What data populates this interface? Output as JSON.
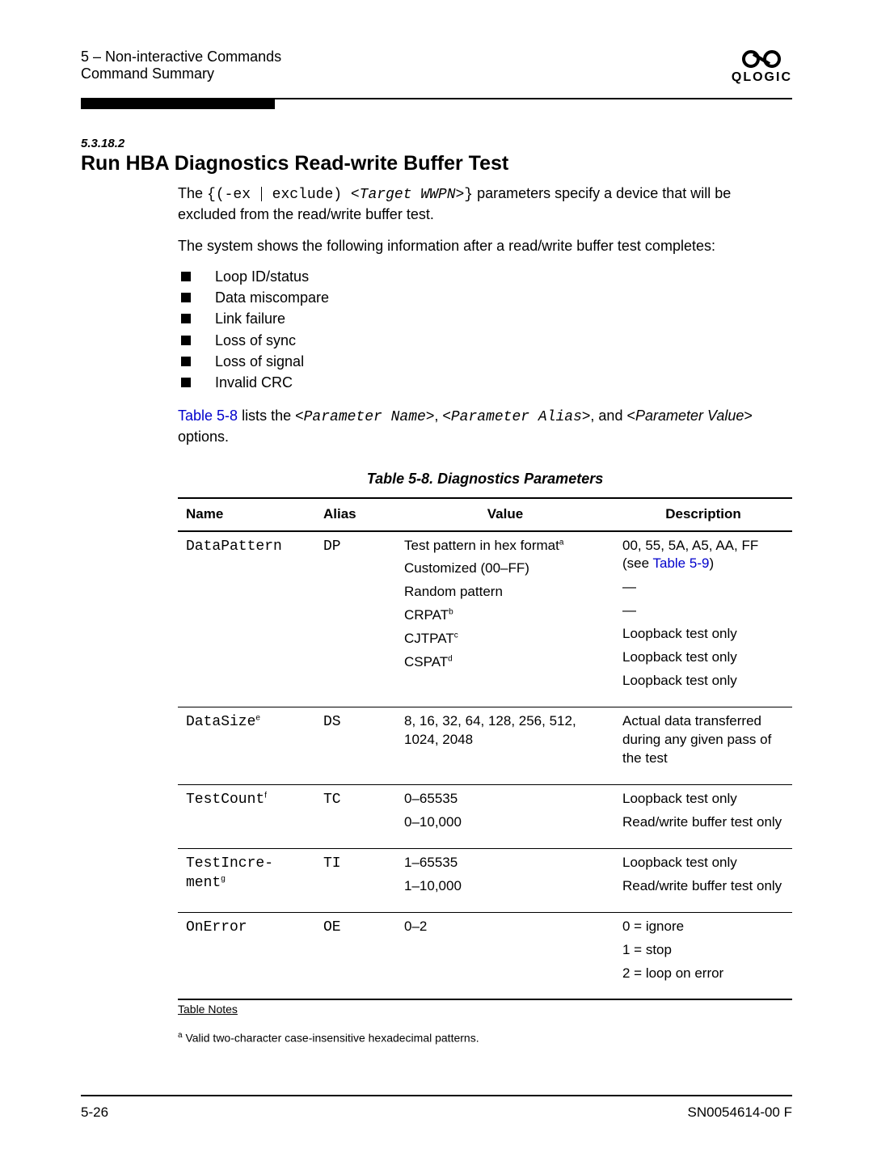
{
  "header": {
    "line1": "5 – Non-interactive Commands",
    "line2": "Command Summary",
    "logo_glyph": "ꭓ",
    "logo_text": "QLOGIC"
  },
  "section": {
    "num": "5.3.18.2",
    "title": "Run HBA Diagnostics Read-write Buffer Test"
  },
  "intro": {
    "p1_parts": {
      "a": "The ",
      "code_a": "{(-ex ",
      "code_b": " exclude) <",
      "code_it": "Target WWPN",
      "code_c": ">}",
      "b": " parameters specify a device that will be excluded from the read/write buffer test."
    },
    "p2": "The system shows the following information after a read/write buffer test completes:",
    "bullets": [
      "Loop ID/status",
      "Data miscompare",
      "Link failure",
      "Loss of sync",
      "Loss of signal",
      "Invalid CRC"
    ],
    "p3_parts": {
      "link": "Table 5-8",
      "t1": " lists the <",
      "m1": "Parameter Name",
      "t2": ">, <",
      "m2": "Parameter Alias",
      "t3": ">, and <",
      "it": "Parameter Value",
      "t4": "> options."
    }
  },
  "table": {
    "caption": "Table 5-8. Diagnostics Parameters",
    "headers": {
      "name": "Name",
      "alias": "Alias",
      "value": "Value",
      "desc": "Description"
    },
    "rows": [
      {
        "name": "DataPattern",
        "alias": "DP",
        "values": [
          {
            "t": "Test pattern in hex format",
            "sup": "a"
          },
          {
            "t": "Customized (00–FF)"
          },
          {
            "t": "Random pattern"
          },
          {
            "t": "CRPAT",
            "sup": "b"
          },
          {
            "t": "CJTPAT",
            "sup": "c"
          },
          {
            "t": "CSPAT",
            "sup": "d"
          }
        ],
        "descs": [
          {
            "t1": "00, 55, 5A, A5, AA, FF",
            "t2": "(see ",
            "link": "Table 5-9",
            "t3": ")"
          },
          {
            "t1": "—"
          },
          {
            "t1": "—"
          },
          {
            "t1": "Loopback test only"
          },
          {
            "t1": "Loopback test only"
          },
          {
            "t1": "Loopback test only"
          }
        ]
      },
      {
        "name": "DataSize",
        "name_sup": "e",
        "alias": "DS",
        "values": [
          {
            "t": "8, 16, 32, 64, 128, 256, 512, 1024, 2048"
          }
        ],
        "descs": [
          {
            "t1": "Actual data transferred during any given pass of the test"
          }
        ]
      },
      {
        "name": "TestCount",
        "name_sup": "f",
        "alias": "TC",
        "values": [
          {
            "t": "0–65535"
          },
          {
            "t": "0–10,000"
          }
        ],
        "descs": [
          {
            "t1": "Loopback test only"
          },
          {
            "t1": "Read/write buffer test only"
          }
        ]
      },
      {
        "name": "TestIncre-ment",
        "name_sup": "g",
        "alias": "TI",
        "values": [
          {
            "t": "1–65535"
          },
          {
            "t": "1–10,000"
          }
        ],
        "descs": [
          {
            "t1": "Loopback test only"
          },
          {
            "t1": "Read/write buffer test only"
          }
        ]
      },
      {
        "name": "OnError",
        "alias": "OE",
        "values": [
          {
            "t": "0–2"
          }
        ],
        "descs": [
          {
            "t1": "0 = ignore"
          },
          {
            "t1": "1 = stop"
          },
          {
            "t1": "2 = loop on error"
          }
        ]
      }
    ],
    "notes_label": "Table Notes",
    "footnote_sup": "a",
    "footnote_text": " Valid two-character case-insensitive hexadecimal patterns."
  },
  "footer": {
    "left": "5-26",
    "right": "SN0054614-00  F"
  }
}
